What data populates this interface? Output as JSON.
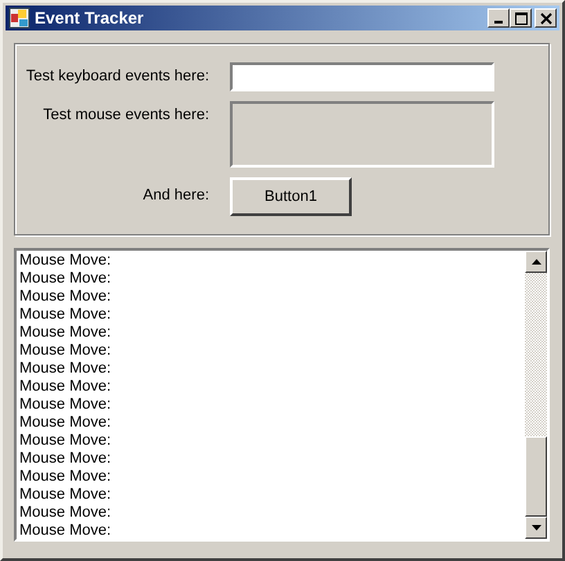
{
  "window": {
    "title": "Event Tracker"
  },
  "form": {
    "keyboard_label": "Test keyboard events here:",
    "mouse_label": "Test mouse events here:",
    "button_label": "And here:",
    "button": "Button1"
  },
  "log": [
    "Mouse Move:",
    "Mouse Move:",
    "Mouse Move:",
    "Mouse Move:",
    "Mouse Move:",
    "Mouse Move:",
    "Mouse Move:",
    "Mouse Move:",
    "Mouse Move:",
    "Mouse Move:",
    "Mouse Move:",
    "Mouse Move:",
    "Mouse Move:",
    "Mouse Move:",
    "Mouse Move:",
    "Mouse Move:"
  ]
}
